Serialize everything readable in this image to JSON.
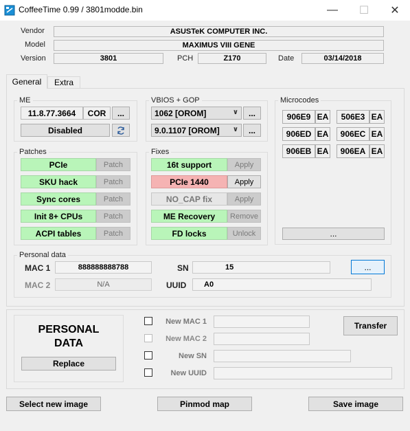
{
  "window": {
    "title": "CoffeeTime 0.99  /  3801modde.bin",
    "minimize": "—",
    "maximize": "☐",
    "close": "✕"
  },
  "info": {
    "vendor_label": "Vendor",
    "vendor": "ASUSTeK COMPUTER INC.",
    "model_label": "Model",
    "model": "MAXIMUS VIII GENE",
    "version_label": "Version",
    "version": "3801",
    "pch_label": "PCH",
    "pch": "Z170",
    "date_label": "Date",
    "date": "03/14/2018"
  },
  "tabs": [
    {
      "label": "General",
      "active": true
    },
    {
      "label": "Extra",
      "active": false
    }
  ],
  "me": {
    "title": "ME",
    "version": "11.8.77.3664",
    "type": "COR",
    "more": "...",
    "status": "Disabled",
    "refresh_icon": "refresh-icon"
  },
  "vbios": {
    "title": "VBIOS + GOP",
    "vbios_value": "1062 [OROM]",
    "gop_value": "9.0.1107 [OROM]",
    "more": "..."
  },
  "microcodes": {
    "title": "Microcodes",
    "items": [
      {
        "code": "906E9",
        "tag": "EA"
      },
      {
        "code": "506E3",
        "tag": "EA"
      },
      {
        "code": "906ED",
        "tag": "EA"
      },
      {
        "code": "906EC",
        "tag": "EA"
      },
      {
        "code": "906EB",
        "tag": "EA"
      },
      {
        "code": "906EA",
        "tag": "EA"
      }
    ],
    "more": "..."
  },
  "patches": {
    "title": "Patches",
    "items": [
      {
        "label": "PCIe",
        "action": "Patch"
      },
      {
        "label": "SKU hack",
        "action": "Patch"
      },
      {
        "label": "Sync cores",
        "action": "Patch"
      },
      {
        "label": "Init 8+ CPUs",
        "action": "Patch"
      },
      {
        "label": "ACPI tables",
        "action": "Patch"
      }
    ]
  },
  "fixes": {
    "title": "Fixes",
    "items": [
      {
        "label": "16t support",
        "action": "Apply"
      },
      {
        "label": "PCIe 1440",
        "action": "Apply"
      },
      {
        "label": "NO_CAP fix",
        "action": "Apply"
      },
      {
        "label": "ME Recovery",
        "action": "Remove"
      },
      {
        "label": "FD locks",
        "action": "Unlock"
      }
    ]
  },
  "personal": {
    "title": "Personal data",
    "mac1_label": "MAC 1",
    "mac1": "888888888788",
    "mac2_label": "MAC 2",
    "mac2": "N/A",
    "sn_label": "SN",
    "sn": "15",
    "uuid_label": "UUID",
    "uuid": "A0",
    "more": "..."
  },
  "transfer": {
    "heading_line1": "PERSONAL",
    "heading_line2": "DATA",
    "replace": "Replace",
    "new_mac1": "New  MAC 1",
    "new_mac2": "New MAC 2",
    "new_sn": "New  SN",
    "new_uuid": "New  UUID",
    "transfer_btn": "Transfer"
  },
  "footer": {
    "select": "Select new image",
    "pinmod": "Pinmod map",
    "save": "Save image"
  }
}
